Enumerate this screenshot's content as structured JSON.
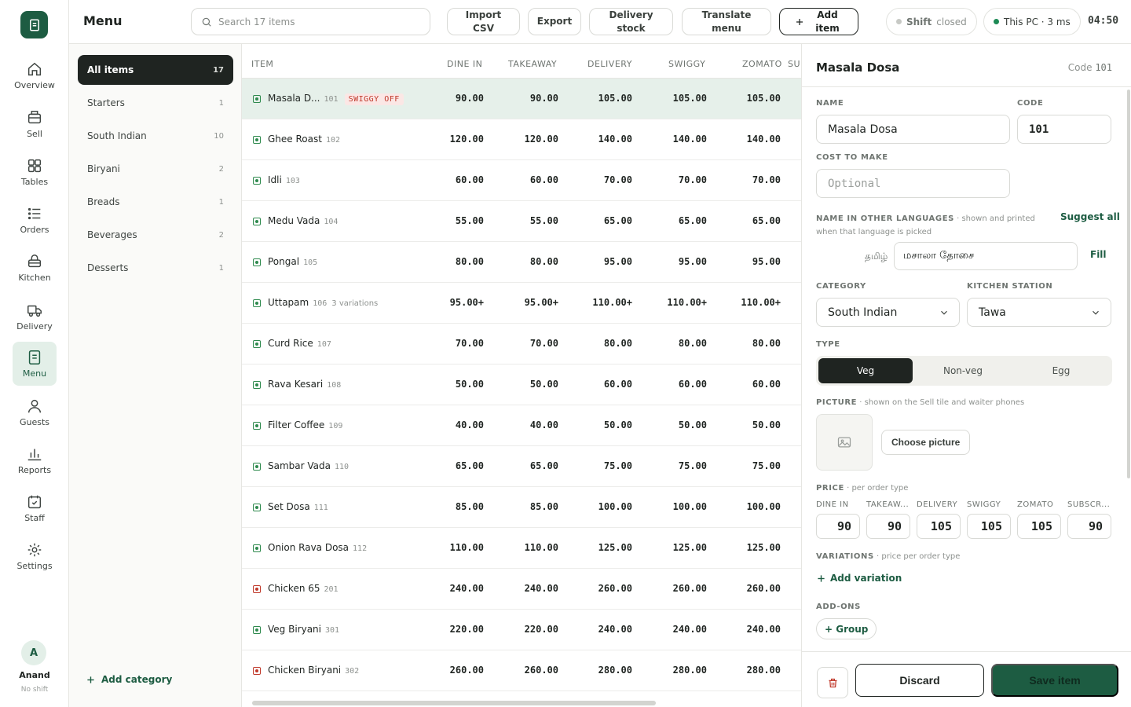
{
  "app": {
    "page_title": "Menu",
    "clock": "04:50"
  },
  "header": {
    "search_placeholder": "Search 17 items",
    "import_label": "Import CSV",
    "export_label": "Export",
    "delivery_stock_label": "Delivery stock",
    "translate_label": "Translate menu",
    "add_item_label": "Add item",
    "shift_label": "Shift",
    "shift_status": "closed",
    "device_label": "This PC · 3 ms",
    "colors": {
      "shift_dot": "#c7c9c5",
      "device_dot": "#1d8a55"
    }
  },
  "rail": {
    "items": [
      {
        "label": "Overview",
        "icon": "home-icon"
      },
      {
        "label": "Sell",
        "icon": "register-icon"
      },
      {
        "label": "Tables",
        "icon": "grid-icon"
      },
      {
        "label": "Orders",
        "icon": "list-icon"
      },
      {
        "label": "Kitchen",
        "icon": "basket-icon"
      },
      {
        "label": "Delivery",
        "icon": "truck-icon"
      },
      {
        "label": "Menu",
        "icon": "menu-icon"
      },
      {
        "label": "Guests",
        "icon": "user-icon"
      },
      {
        "label": "Reports",
        "icon": "bar-chart-icon"
      },
      {
        "label": "Staff",
        "icon": "calendar-check-icon"
      },
      {
        "label": "Settings",
        "icon": "gear-icon"
      }
    ],
    "active": "Menu",
    "user": {
      "initial": "A",
      "name": "Anand",
      "status": "No shift"
    }
  },
  "categories": {
    "items": [
      {
        "label": "All items",
        "count": "17"
      },
      {
        "label": "Starters",
        "count": "1"
      },
      {
        "label": "South Indian",
        "count": "10"
      },
      {
        "label": "Biryani",
        "count": "2"
      },
      {
        "label": "Breads",
        "count": "1"
      },
      {
        "label": "Beverages",
        "count": "2"
      },
      {
        "label": "Desserts",
        "count": "1"
      }
    ],
    "add_label": "Add category"
  },
  "table": {
    "columns": [
      "ITEM",
      "DINE IN",
      "TAKEAWAY",
      "DELIVERY",
      "SWIGGY",
      "ZOMATO",
      "SU"
    ],
    "rows": [
      {
        "name": "Masala D...",
        "code": "101",
        "badge": "SWIGGY OFF",
        "variations": "",
        "type": "veg",
        "prices": [
          "90.00",
          "90.00",
          "105.00",
          "105.00",
          "105.00"
        ]
      },
      {
        "name": "Ghee Roast",
        "code": "102",
        "badge": "",
        "variations": "",
        "type": "veg",
        "prices": [
          "120.00",
          "120.00",
          "140.00",
          "140.00",
          "140.00"
        ]
      },
      {
        "name": "Idli",
        "code": "103",
        "badge": "",
        "variations": "",
        "type": "veg",
        "prices": [
          "60.00",
          "60.00",
          "70.00",
          "70.00",
          "70.00"
        ]
      },
      {
        "name": "Medu Vada",
        "code": "104",
        "badge": "",
        "variations": "",
        "type": "veg",
        "prices": [
          "55.00",
          "55.00",
          "65.00",
          "65.00",
          "65.00"
        ]
      },
      {
        "name": "Pongal",
        "code": "105",
        "badge": "",
        "variations": "",
        "type": "veg",
        "prices": [
          "80.00",
          "80.00",
          "95.00",
          "95.00",
          "95.00"
        ]
      },
      {
        "name": "Uttapam",
        "code": "106",
        "badge": "",
        "variations": "3 variations",
        "type": "veg",
        "prices": [
          "95.00+",
          "95.00+",
          "110.00+",
          "110.00+",
          "110.00+"
        ]
      },
      {
        "name": "Curd Rice",
        "code": "107",
        "badge": "",
        "variations": "",
        "type": "veg",
        "prices": [
          "70.00",
          "70.00",
          "80.00",
          "80.00",
          "80.00"
        ]
      },
      {
        "name": "Rava Kesari",
        "code": "108",
        "badge": "",
        "variations": "",
        "type": "veg",
        "prices": [
          "50.00",
          "50.00",
          "60.00",
          "60.00",
          "60.00"
        ]
      },
      {
        "name": "Filter Coffee",
        "code": "109",
        "badge": "",
        "variations": "",
        "type": "veg",
        "prices": [
          "40.00",
          "40.00",
          "50.00",
          "50.00",
          "50.00"
        ]
      },
      {
        "name": "Sambar Vada",
        "code": "110",
        "badge": "",
        "variations": "",
        "type": "veg",
        "prices": [
          "65.00",
          "65.00",
          "75.00",
          "75.00",
          "75.00"
        ]
      },
      {
        "name": "Set Dosa",
        "code": "111",
        "badge": "",
        "variations": "",
        "type": "veg",
        "prices": [
          "85.00",
          "85.00",
          "100.00",
          "100.00",
          "100.00"
        ]
      },
      {
        "name": "Onion Rava Dosa",
        "code": "112",
        "badge": "",
        "variations": "",
        "type": "veg",
        "prices": [
          "110.00",
          "110.00",
          "125.00",
          "125.00",
          "125.00"
        ]
      },
      {
        "name": "Chicken 65",
        "code": "201",
        "badge": "",
        "variations": "",
        "type": "nonveg",
        "prices": [
          "240.00",
          "240.00",
          "260.00",
          "260.00",
          "260.00"
        ]
      },
      {
        "name": "Veg Biryani",
        "code": "301",
        "badge": "",
        "variations": "",
        "type": "veg",
        "prices": [
          "220.00",
          "220.00",
          "240.00",
          "240.00",
          "240.00"
        ]
      },
      {
        "name": "Chicken Biryani",
        "code": "302",
        "badge": "",
        "variations": "",
        "type": "nonveg",
        "prices": [
          "260.00",
          "260.00",
          "280.00",
          "280.00",
          "280.00"
        ]
      }
    ]
  },
  "detail": {
    "title": "Masala Dosa",
    "code_label": "Code",
    "code_value": "101",
    "name_label": "NAME",
    "name_value": "Masala Dosa",
    "code_field_label": "CODE",
    "code_field_value": "101",
    "cost_label": "COST TO MAKE",
    "cost_placeholder": "Optional",
    "lang_label": "NAME IN OTHER LANGUAGES",
    "lang_note": " · shown and printed when that language is picked",
    "suggest_label": "Suggest all",
    "lang_name": "தமிழ்",
    "lang_value": "மசாலா தோசை",
    "fill_label": "Fill",
    "category_label": "CATEGORY",
    "category_value": "South Indian",
    "station_label": "KITCHEN STATION",
    "station_value": "Tawa",
    "type_label": "TYPE",
    "types": [
      "Veg",
      "Non-veg",
      "Egg"
    ],
    "picture_label": "PICTURE",
    "picture_note": " · shown on the Sell tile and waiter phones",
    "choose_picture": "Choose picture",
    "price_label": "PRICE",
    "price_note": " · per order type",
    "price_types": [
      "DINE IN",
      "TAKEAW...",
      "DELIVERY",
      "SWIGGY",
      "ZOMATO",
      "SUBSCR..."
    ],
    "price_values": [
      "90",
      "90",
      "105",
      "105",
      "105",
      "90"
    ],
    "variations_label": "VARIATIONS",
    "variations_note": " · price per order type",
    "add_variation": "Add variation",
    "addons_label": "ADD-ONS",
    "group_label": "+ Group",
    "discard_label": "Discard",
    "save_label": "Save item"
  }
}
